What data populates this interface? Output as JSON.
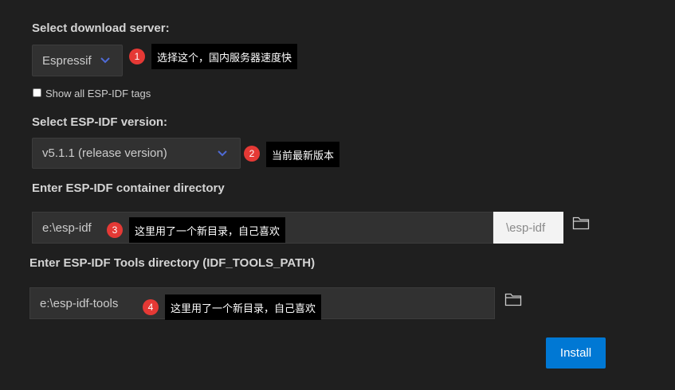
{
  "server": {
    "label": "Select download server:",
    "selected": "Espressif",
    "show_all_label": "Show all ESP-IDF tags",
    "show_all_checked": false,
    "badge": "1",
    "tip": "选择这个，国内服务器速度快"
  },
  "version": {
    "label": "Select ESP-IDF version:",
    "selected": "v5.1.1 (release version)",
    "badge": "2",
    "tip": "当前最新版本"
  },
  "container": {
    "label": "Enter ESP-IDF container directory",
    "value": "e:\\esp-idf",
    "suffix": "\\esp-idf",
    "badge": "3",
    "tip": "这里用了一个新目录，自己喜欢"
  },
  "tools": {
    "label": "Enter ESP-IDF Tools directory (IDF_TOOLS_PATH)",
    "value": "e:\\esp-idf-tools",
    "badge": "4",
    "tip": "这里用了一个新目录，自己喜欢"
  },
  "install_label": "Install",
  "colors": {
    "background": "#1f1f1f",
    "accent": "#0078d4",
    "badge": "#e53935",
    "chevron": "#4f6bd6"
  }
}
